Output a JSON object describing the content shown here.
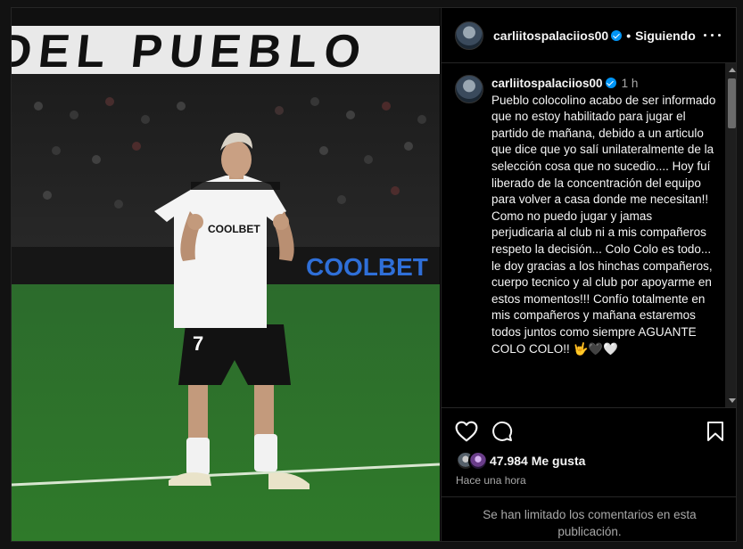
{
  "post": {
    "username": "carliitospalaciios00",
    "follow_label": "Siguiendo",
    "separator": "•",
    "caption": {
      "username": "carliitospalaciios00",
      "time": "1 h",
      "text": "Pueblo colocolino acabo de ser informado que no estoy habilitado para jugar el partido de mañana, debido a un articulo que dice que yo salí unilateralmente de la selección cosa que no sucedio.... Hoy fuí liberado de la concentración del equipo para volver a casa donde me necesitan!! Como no puedo jugar y jamas perjudicaria al club ni a mis compañeros respeto la decisión... Colo Colo es todo... le doy gracias a los hinchas compañeros, cuerpo tecnico y al club por apoyarme en estos momentos!!! Confío totalmente en mis compañeros y mañana estaremos todos juntos como siempre AGUANTE COLO COLO!! 🤟🖤🤍"
    },
    "likes": "47.984 Me gusta",
    "time_ago": "Hace una hora",
    "comments_limited": "Se han limitado los comentarios en esta publicación.",
    "image": {
      "banner_text": "DEL PUEBLO",
      "shirt_sponsor": "COOLBET",
      "shirt_number": "7",
      "board_text": "COOLBET"
    }
  },
  "icons": {
    "like": "heart-outline",
    "comment": "comment-bubble",
    "save": "bookmark-outline",
    "more": "more-horizontal",
    "verified": "verified-badge"
  },
  "colors": {
    "background": "#000000",
    "text": "#f5f5f5",
    "muted": "#a8a8a8",
    "verified": "#0095f6",
    "border": "#262626"
  }
}
